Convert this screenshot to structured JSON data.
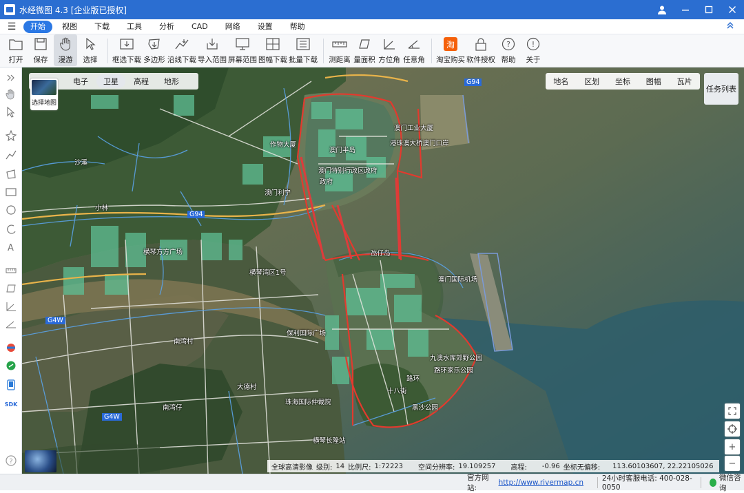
{
  "window": {
    "title": "水经微图 4.3 [企业版已授权]"
  },
  "menu": {
    "items": [
      "开始",
      "视图",
      "下载",
      "工具",
      "分析",
      "CAD",
      "网络",
      "设置",
      "帮助"
    ],
    "active": "开始"
  },
  "toolbar": {
    "open": "打开",
    "save": "保存",
    "pan": "漫游",
    "select": "选择",
    "box_download": "框选下载",
    "polygon": "多边形",
    "line_download": "沿线下载",
    "import_range": "导入范围",
    "screen_range": "屏幕范围",
    "sheet_download": "图幅下载",
    "batch_download": "批量下载",
    "measure_distance": "测距离",
    "measure_area": "量面积",
    "azimuth": "方位角",
    "any_angle": "任意角",
    "taobao": "淘宝购买",
    "license": "软件授权",
    "help": "帮助",
    "about": "关于",
    "taobao_icon_text": "淘"
  },
  "layers": {
    "thumb_label": "选择地图",
    "tabs": [
      "电子",
      "卫星",
      "高程",
      "地形"
    ],
    "active": "卫星"
  },
  "query_panel": [
    "地名",
    "区划",
    "坐标",
    "图幅",
    "瓦片"
  ],
  "task_list": "任务列表",
  "map_labels": {
    "g94_top": "G94",
    "aomen_gongyu": "澳门工业大厦",
    "gangzhuao": "港珠澳大桥澳门口岸",
    "aomen_banshi": "澳门特别行政区政府",
    "zhengfu": "政府",
    "aomen_bandao": "澳门半岛",
    "aomen_fudao": "氹仔岛",
    "g94_left": "G94",
    "shajiang": "沙溪",
    "xiaolin": "小林",
    "yingwushan": "作物大厦",
    "aomen_lidao": "澳门利宁",
    "hengqin_plaza": "横琴方方广场",
    "hengqin_wan": "横琴湾区1号",
    "aomen_airport": "澳门国际机场",
    "baoli": "保利国际广场",
    "hengqin_village": "南湾村",
    "aomen_dade": "大德村",
    "g4w": "G4W",
    "zhuhai_court": "珠海国际仲裁院",
    "nanwanzai": "南湾仔",
    "hengqin_station": "横琴长隆站",
    "park1": "九澳水库郊野公园",
    "park2": "路环家乐公园",
    "park3": "黑沙公园",
    "luhuan": "路环",
    "shibajie": "十八街",
    "g4w_bottom": "G4W"
  },
  "status": {
    "source_label": "全球高清影像",
    "level_label": "级别:",
    "level": "14",
    "scale_label": "比例尺:",
    "scale": "1:72223",
    "res_label": "空间分辨率:",
    "resolution": "19.109257",
    "elev_label": "高程:",
    "elevation": "-0.96",
    "coord_label": "坐标无偏移:",
    "coords": "113.60103607, 22.22105026"
  },
  "footer": {
    "site_label": "官方网站:",
    "site_url": "http://www.rivermap.cn",
    "phone": "24小时客服电话: 400-028-0050",
    "wechat": "微信咨询"
  },
  "colors": {
    "title_bar": "#2b6ed1",
    "menu_active": "#2b78e4",
    "border_red": "#e23a2e",
    "road_blue": "#5aa2e6"
  }
}
